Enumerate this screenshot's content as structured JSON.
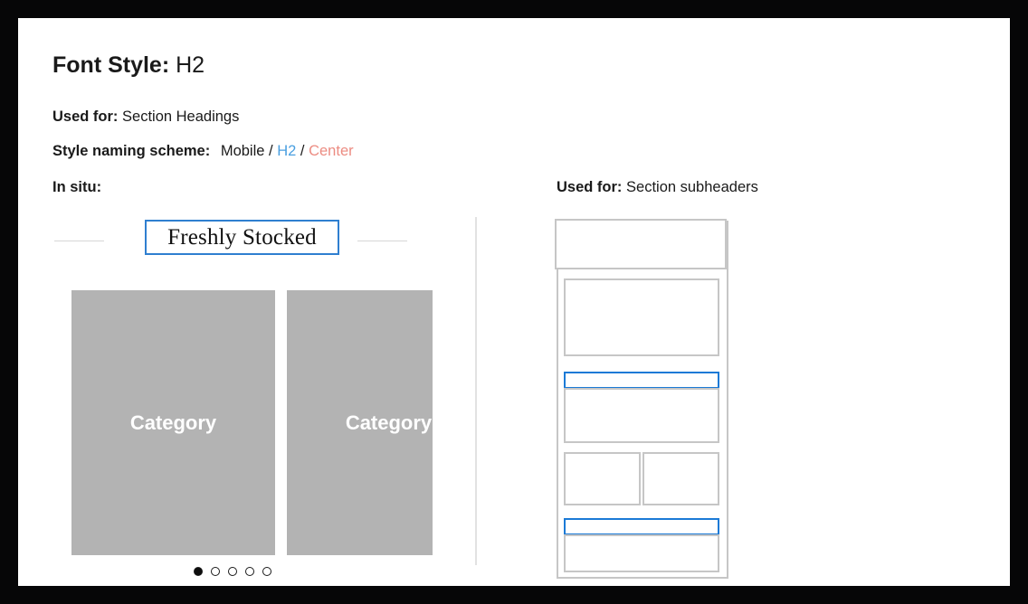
{
  "header": {
    "title_label": "Font Style:",
    "title_value": "H2"
  },
  "meta": {
    "used_for_label": "Used for:",
    "used_for_value": "Section Headings",
    "scheme_label": "Style naming scheme:",
    "scheme_platform": "Mobile",
    "scheme_separator_1": "/",
    "scheme_style": "H2",
    "scheme_separator_2": "/",
    "scheme_alignment": "Center",
    "in_situ_label": "In situ:"
  },
  "right_panel": {
    "used_for_label": "Used for:",
    "used_for_value": "Section subheaders"
  },
  "in_situ": {
    "section_heading": "Freshly Stocked",
    "cards": [
      {
        "label": "Category"
      },
      {
        "label": "Category"
      }
    ],
    "pagination": {
      "total": 5,
      "active_index": 0
    }
  },
  "colors": {
    "accent_blue": "#1b7ad6",
    "selection_blue": "#2f7fd0",
    "scheme_blue": "#4a9fe0",
    "scheme_salmon": "#ec8c82",
    "card_gray": "#b3b3b3",
    "wire_gray": "#c6c6c6",
    "page_border": "#060607"
  }
}
